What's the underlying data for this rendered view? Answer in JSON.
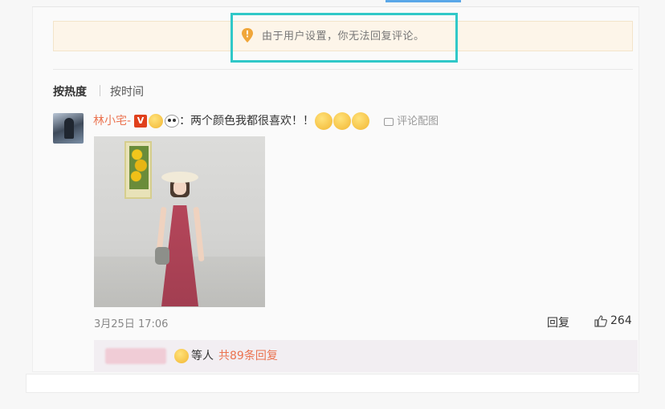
{
  "notice": {
    "icon": "location-pin-icon",
    "icon_color": "#f0a63a",
    "text": "由于用户设置，你无法回复评论。"
  },
  "sort": {
    "hot_label": "按热度",
    "time_label": "按时间"
  },
  "comment": {
    "username": "林小宅-",
    "text": "：两个颜色我都很喜欢！！",
    "report_label": "评论配图",
    "date": "3月25日 17:06",
    "reply_label": "回复",
    "like_count": "264"
  },
  "replies": {
    "summary": "等人",
    "more_link": "共89条回复"
  },
  "colors": {
    "accent": "#eb7350",
    "highlight": "#30c8c8",
    "notice_bg": "#fdf5e9"
  }
}
